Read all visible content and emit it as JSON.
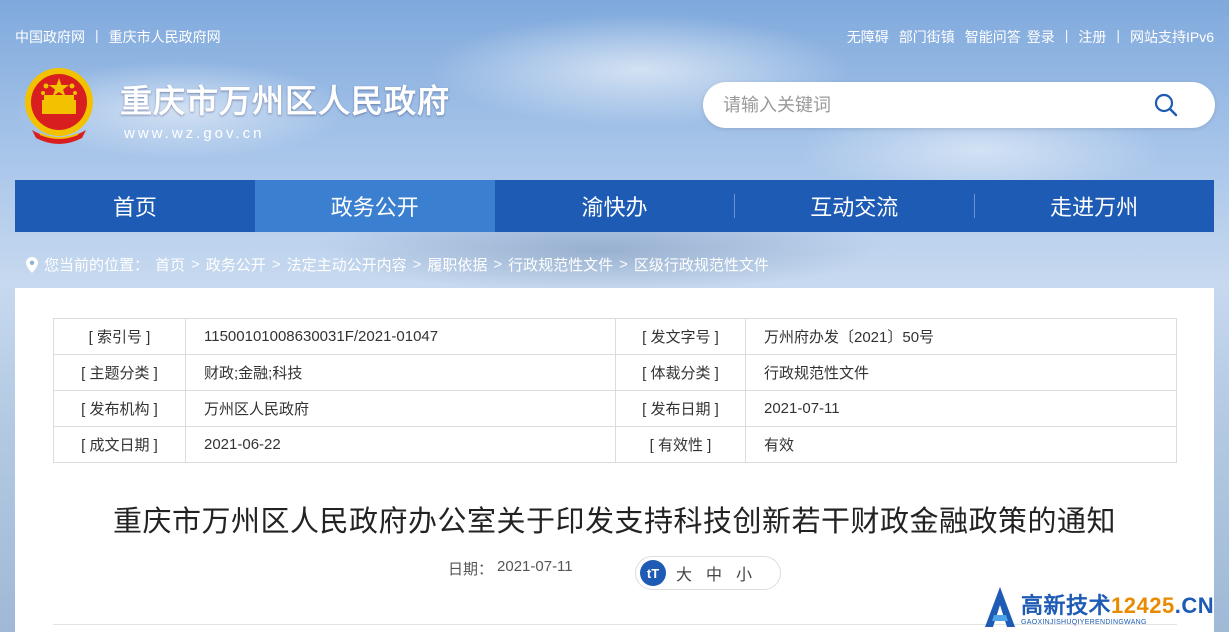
{
  "topbar": {
    "left_links": [
      "中国政府网",
      "重庆市人民政府网"
    ],
    "right_links": [
      "无障碍",
      "部门街镇",
      "智能问答",
      "登录",
      "注册",
      "网站支持IPv6"
    ],
    "separator": "|"
  },
  "header": {
    "site_title": "重庆市万州区人民政府",
    "site_url": "www.wz.gov.cn",
    "search_placeholder": "请输入关键词"
  },
  "nav": {
    "items": [
      "首页",
      "政务公开",
      "渝快办",
      "互动交流",
      "走进万州"
    ],
    "active_index": 1
  },
  "breadcrumb": {
    "prefix": "您当前的位置：",
    "items": [
      "首页",
      "政务公开",
      "法定主动公开内容",
      "履职依据",
      "行政规范性文件",
      "区级行政规范性文件"
    ],
    "arrow": ">"
  },
  "meta": {
    "rows": [
      {
        "k1": "[ 索引号 ]",
        "v1": "11500101008630031F/2021-01047",
        "k2": "[ 发文字号 ]",
        "v2": "万州府办发〔2021〕50号"
      },
      {
        "k1": "[ 主题分类 ]",
        "v1": "财政;金融;科技",
        "k2": "[ 体裁分类 ]",
        "v2": "行政规范性文件"
      },
      {
        "k1": "[ 发布机构 ]",
        "v1": "万州区人民政府",
        "k2": "[ 发布日期 ]",
        "v2": "2021-07-11"
      },
      {
        "k1": "[ 成文日期 ]",
        "v1": "2021-06-22",
        "k2": "[ 有效性 ]",
        "v2": "有效"
      }
    ]
  },
  "article": {
    "title": "重庆市万州区人民政府办公室关于印发支持科技创新若干财政金融政策的通知",
    "date_label": "日期：",
    "date": "2021-07-11",
    "fontsize_icon": "tT",
    "fontsize_options": [
      "大",
      "中",
      "小"
    ]
  },
  "watermark": {
    "brand_text": "高新技术",
    "brand_num": "12425",
    "brand_tld": ".CN",
    "sub": "GAOXINJISHUQIYERENDINGWANG"
  },
  "colors": {
    "nav_bg": "#1d5bb4",
    "nav_active": "#3b7fd0",
    "emblem_red": "#d81e1e",
    "emblem_gold": "#f2c200"
  },
  "icons": {
    "search": "search-icon",
    "location": "location-pin-icon",
    "emblem": "national-emblem-icon"
  }
}
